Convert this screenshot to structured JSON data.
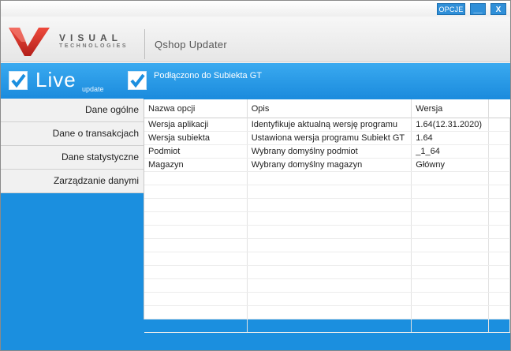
{
  "window": {
    "buttons": {
      "options": "OPCJE",
      "minimize": "__",
      "close": "X"
    }
  },
  "header": {
    "logo_line1": "VISUAL",
    "logo_line2": "TECHNOLOGIES",
    "app_title": "Qshop Updater"
  },
  "bluebar": {
    "live": "Live",
    "live_sub": "update",
    "connection": "Podłączono do Subiekta GT"
  },
  "sidebar": {
    "items": [
      {
        "label": "Dane ogólne"
      },
      {
        "label": "Dane o transakcjach"
      },
      {
        "label": "Dane statystyczne"
      },
      {
        "label": "Zarządzanie danymi"
      }
    ]
  },
  "table": {
    "columns": [
      "Nazwa opcji",
      "Opis",
      "Wersja",
      ""
    ],
    "rows": [
      [
        "Wersja aplikacji",
        "Identyfikuje aktualną wersję programu",
        "1.64(12.31.2020)",
        ""
      ],
      [
        "Wersja subiekta",
        "Ustawiona wersja programu Subiekt GT",
        "1.64",
        ""
      ],
      [
        "Podmiot",
        "Wybrany domyślny podmiot",
        "_1_64",
        ""
      ],
      [
        "Magazyn",
        "Wybrany domyślny magazyn",
        "Główny",
        ""
      ]
    ]
  },
  "colors": {
    "accent": "#1b8fdf",
    "logo_red": "#d9312b"
  }
}
